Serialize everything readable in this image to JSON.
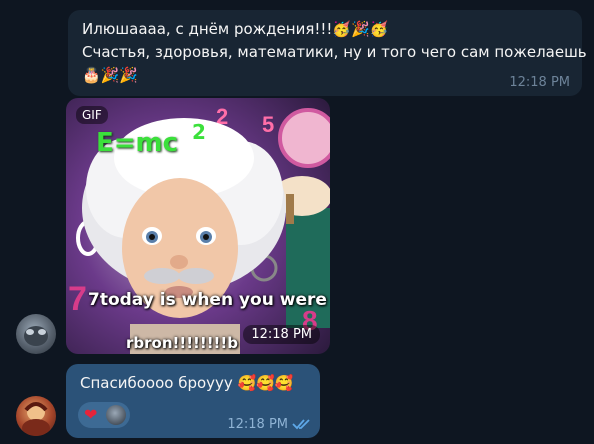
{
  "messages": {
    "incoming_text": {
      "line1": "Илюшаааа, с днём рождения!!!",
      "line1_emojis": "🥳🎉🥳",
      "line2": "Счастья, здоровья, математики, ну и того чего сам пожелаешь",
      "line3_emojis": "🎂🎉🎉",
      "time": "12:18 PM"
    },
    "gif": {
      "badge": "GIF",
      "formula": "E=mc",
      "formula_sup": "2",
      "caption_line1": "7today is when you were",
      "caption_line2": "rbron!!!!!!!!b",
      "time": "12:18 PM"
    },
    "outgoing": {
      "text": "Спасибоooo броуyy",
      "emojis": "🥰🥰🥰",
      "reaction_icon": "heart-icon",
      "time": "12:18 PM",
      "status_icon": "double-check-icon"
    }
  },
  "colors": {
    "background": "#0e1621",
    "incoming_bubble": "#182533",
    "outgoing_bubble": "#2b5278",
    "time_incoming": "#6d8399",
    "time_outgoing": "#8fb3d4",
    "read_check": "#5ea8e8"
  }
}
